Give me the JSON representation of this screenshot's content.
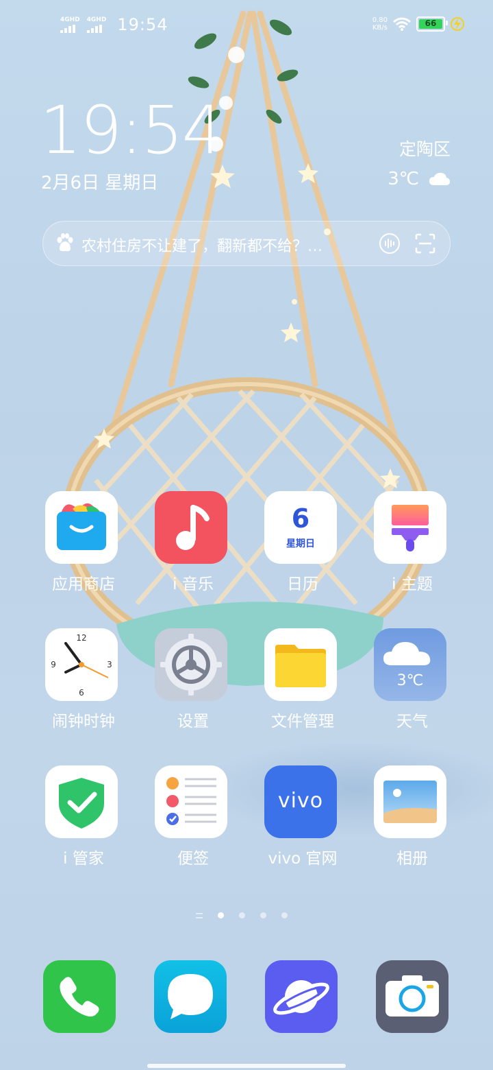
{
  "status_bar": {
    "sim1": "4GHD",
    "sim2": "4GHD",
    "time": "19:54",
    "speed_value": "0.80",
    "speed_unit": "KB/s",
    "battery": "66"
  },
  "widget": {
    "clock": "19:54",
    "date": "2月6日  星期日",
    "location": "定陶区",
    "temperature": "3℃"
  },
  "search": {
    "text": "农村住房不让建了，翻新都不给？…"
  },
  "apps": [
    {
      "label": "应用商店",
      "icon": "app-store-icon"
    },
    {
      "label": "i 音乐",
      "icon": "music-icon"
    },
    {
      "label": "日历",
      "icon": "calendar-icon",
      "day": "6",
      "weekday": "星期日"
    },
    {
      "label": "i 主题",
      "icon": "theme-brush-icon"
    },
    {
      "label": "闹钟时钟",
      "icon": "clock-icon"
    },
    {
      "label": "设置",
      "icon": "settings-gear-icon"
    },
    {
      "label": "文件管理",
      "icon": "folder-icon"
    },
    {
      "label": "天气",
      "icon": "weather-icon",
      "temp": "3℃"
    },
    {
      "label": "i 管家",
      "icon": "shield-check-icon"
    },
    {
      "label": "便签",
      "icon": "notes-icon"
    },
    {
      "label": "vivo 官网",
      "icon": "vivo-logo-icon",
      "logo": "vivo"
    },
    {
      "label": "相册",
      "icon": "gallery-icon"
    }
  ],
  "dock": [
    {
      "icon": "phone-icon"
    },
    {
      "icon": "messages-icon"
    },
    {
      "icon": "browser-planet-icon"
    },
    {
      "icon": "camera-icon"
    }
  ],
  "page_indicator": {
    "pages": 4,
    "current": 1
  },
  "colors": {
    "background": "#c2d7eb",
    "music": "#f2535e",
    "phone": "#30c44b",
    "messages": "#12b3e0",
    "browser": "#5b5cf0",
    "camera": "#5a5f74",
    "vivo": "#3b72ea",
    "shield": "#2fc36a"
  }
}
